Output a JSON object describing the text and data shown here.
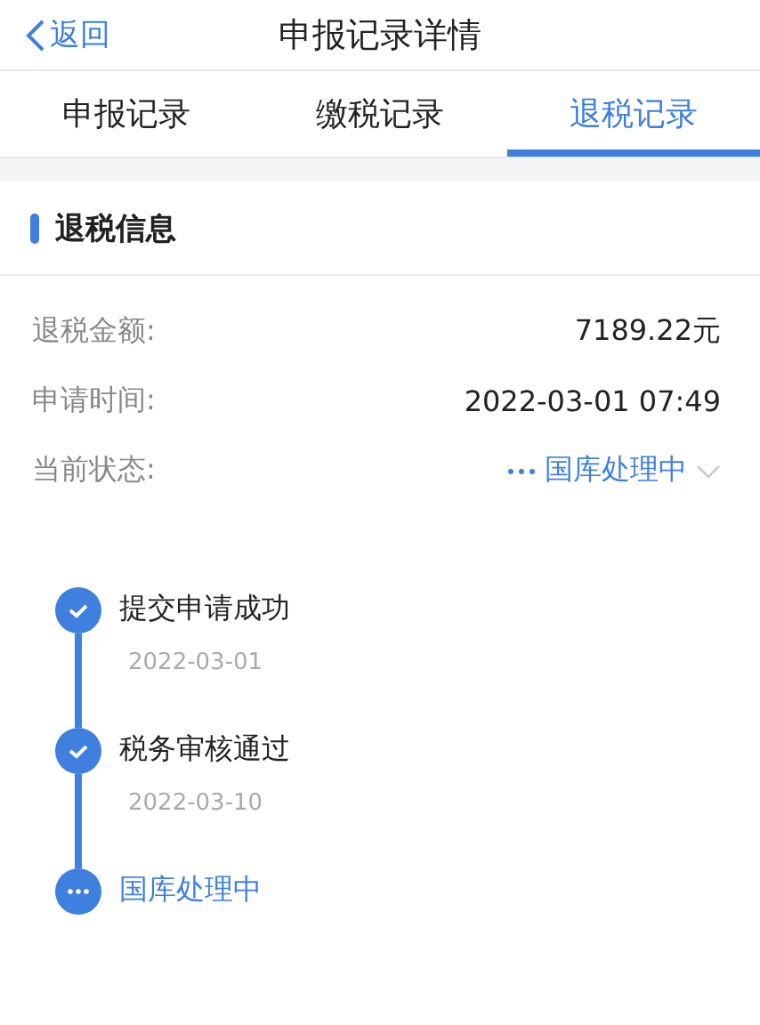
{
  "header": {
    "back": "返回",
    "title": "申报记录详情"
  },
  "tabs": [
    {
      "label": "申报记录",
      "selected": false
    },
    {
      "label": "缴税记录",
      "selected": false
    },
    {
      "label": "退税记录",
      "selected": true
    }
  ],
  "section": {
    "title": "退税信息"
  },
  "fields": [
    {
      "label": "退税金额:",
      "value": "7189.22元",
      "kind": "text"
    },
    {
      "label": "申请时间:",
      "value": "2022-03-01 07:49",
      "kind": "text"
    },
    {
      "label": "当前状态:",
      "value": "国库处理中",
      "kind": "status"
    }
  ],
  "timeline": [
    {
      "title": "提交申请成功",
      "date": "2022-03-01",
      "kind": "done"
    },
    {
      "title": "税务审核通过",
      "date": "2022-03-10",
      "kind": "done"
    },
    {
      "title": "国库处理中",
      "kind": "current"
    }
  ]
}
